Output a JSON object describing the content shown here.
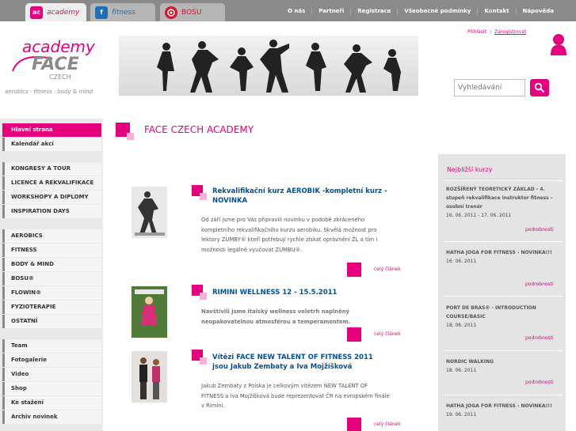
{
  "tabs": [
    {
      "label": "academy",
      "badge": "ac",
      "color": "#e6007e"
    },
    {
      "label": "fitness",
      "badge": "f",
      "color": "#1f6fb8"
    },
    {
      "label": "BOSU",
      "badge": "",
      "color": "#d6142a"
    }
  ],
  "topnav": [
    "O nás",
    "Partneři",
    "Registrace",
    "Všeobecné podmínky",
    "Kontakt",
    "Nápověda"
  ],
  "logo": {
    "text1": "academy",
    "text2": "FACE",
    "text3": "CZECH",
    "tagline": "aerobics · fitness · body & mind"
  },
  "auth": {
    "login": "Přihlásit",
    "separator": "|",
    "register": "Zaregistrovat"
  },
  "search": {
    "placeholder": "Vyhledávání"
  },
  "sidebar": [
    {
      "label": "Hlavní strana",
      "active": true
    },
    {
      "label": "Kalendář akcí"
    },
    {
      "label": "KONGRESY A TOUR"
    },
    {
      "label": "LICENCE A REKVALIFIKACE"
    },
    {
      "label": "WORKSHOPY A DIPLOMY"
    },
    {
      "label": "INSPIRATION DAYS"
    },
    {
      "label": "AEROBICS"
    },
    {
      "label": "FITNESS"
    },
    {
      "label": "BODY & MIND"
    },
    {
      "label": "BOSU®"
    },
    {
      "label": "FLOWIN®"
    },
    {
      "label": "FYZIOTERAPIE"
    },
    {
      "label": "OSTATNÍ"
    },
    {
      "label": "Team"
    },
    {
      "label": "Fotogalerie"
    },
    {
      "label": "Video"
    },
    {
      "label": "Shop"
    },
    {
      "label": "Ke stažení"
    },
    {
      "label": "Archiv novinek"
    }
  ],
  "page_title": "FACE CZECH ACADEMY",
  "articles": [
    {
      "title": "Rekvalifikační kurz AEROBIK -kompletní kurz - NOVINKA",
      "body": "Od září jsme pro Vás připravili novinku v podobě zkráceného kompletního rekvalifikačního kurzu aerobiku. Skvělá možnost pro lektory ZUMBY® kteří potřebují rychle získat oprávnění ŽL a tím i možnosti legálně vyučovat ZUMBU®.",
      "more": "celý článek"
    },
    {
      "title": "RIMINI WELLNESS 12 - 15.5.2011",
      "body": "Navštívili jsme italský wellness veletrh naplněný neopakovatelnou atmosférou a temperamentem.",
      "more": "celý článek"
    },
    {
      "title": "Vítězi FACE NEW TALENT OF FITNESS 2011 jsou Jakub Zembaty a Iva Mojžíšková",
      "body": "Jakub Zembaty z Polska je celkovým vítězem NEW TALENT OF FITNESS a Iva Mojžíšková bude reprezentovat ČR na evropském finále v Rimini.",
      "more": "celý článek"
    }
  ],
  "courses_title": "Nejbližší kurzy",
  "courses": [
    {
      "title": "ROZŠÍŘENÝ TEORETICKÝ ZÁKLAD - 4. stupeň rekvalifikace instruktor fitness – osobní trenér",
      "date": "16. 06. 2011 - 17. 06. 2011",
      "detail": "podrobnosti"
    },
    {
      "title": "HATHA JOGA FOR FITNESS - NOVINKA!!!",
      "date": "16. 06. 2011",
      "detail": "podrobnosti"
    },
    {
      "title": "PORT DE BRAS® - INTRODUCTION COURSE/BASIC",
      "date": "18. 06. 2011",
      "detail": "podrobnosti"
    },
    {
      "title": "NORDIC WALKING",
      "date": "18. 06. 2011",
      "detail": "podrobnosti"
    },
    {
      "title": "HATHA JOGA FOR FITNESS - NOVINKA!!!",
      "date": "19. 06. 2011",
      "detail": ""
    }
  ],
  "colors": {
    "accent": "#e6007e",
    "link": "#00509b",
    "topbar": "#8a8a8a"
  }
}
